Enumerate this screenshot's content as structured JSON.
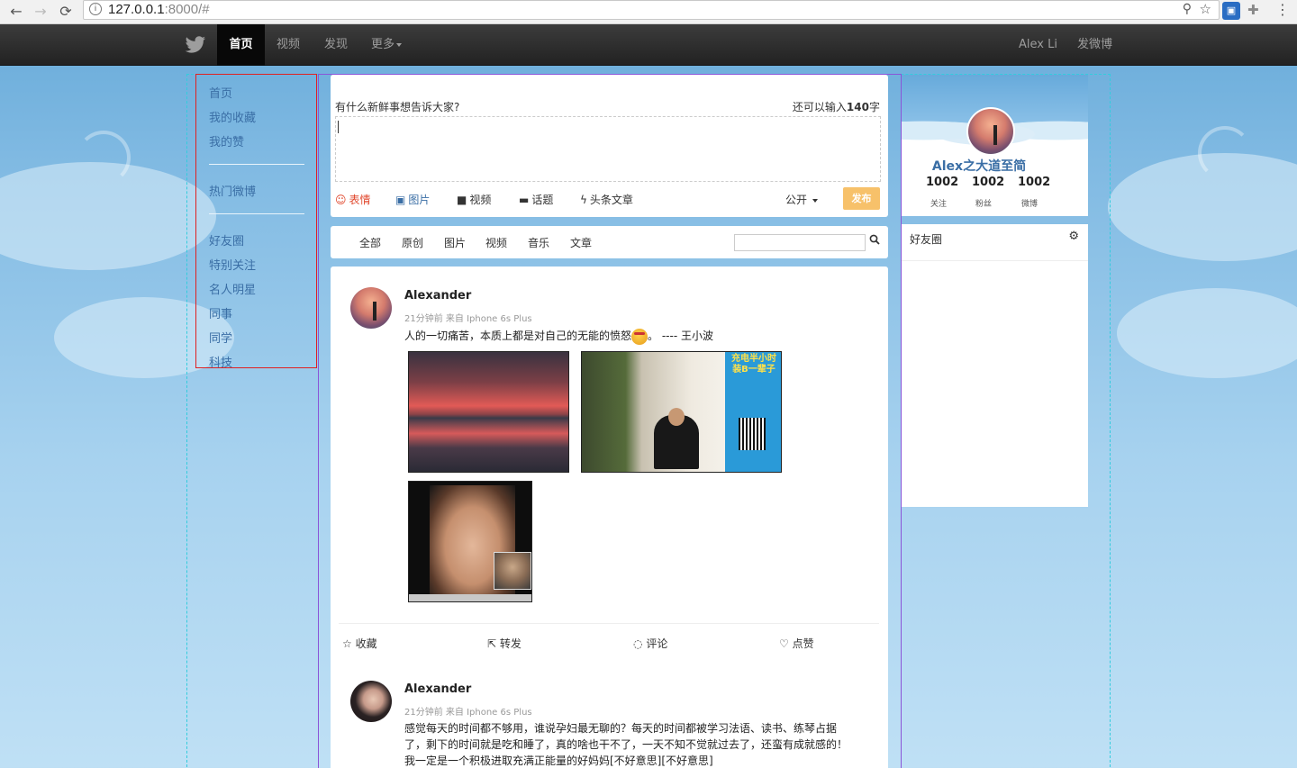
{
  "browser": {
    "url_host": "127.0.0.1",
    "url_path": ":8000/#"
  },
  "navbar": {
    "tabs": [
      {
        "label": "首页"
      },
      {
        "label": "视频"
      },
      {
        "label": "发现"
      },
      {
        "label": "更多"
      }
    ],
    "user_name": "Alex Li",
    "post_link": "发微博"
  },
  "sidebar": {
    "items": [
      {
        "label": "首页"
      },
      {
        "label": "我的收藏"
      },
      {
        "label": "我的赞"
      },
      {
        "label": "热门微博"
      },
      {
        "label": "好友圈"
      },
      {
        "label": "特别关注"
      },
      {
        "label": "名人明星"
      },
      {
        "label": "同事"
      },
      {
        "label": "同学"
      },
      {
        "label": "科技"
      }
    ]
  },
  "composer": {
    "prompt": "有什么新鲜事想告诉大家?",
    "count_prefix": "还可以输入",
    "count_number": "140",
    "count_suffix": "字",
    "tools": [
      {
        "label": "表情",
        "icon": "smile-icon"
      },
      {
        "label": "图片",
        "icon": "image-icon"
      },
      {
        "label": "视频",
        "icon": "video-icon"
      },
      {
        "label": "话题",
        "icon": "topic-icon"
      },
      {
        "label": "头条文章",
        "icon": "bolt-icon"
      }
    ],
    "visibility": "公开",
    "publish_label": "发布"
  },
  "filters": {
    "tabs": [
      {
        "label": "全部"
      },
      {
        "label": "原创"
      },
      {
        "label": "图片"
      },
      {
        "label": "视频"
      },
      {
        "label": "音乐"
      },
      {
        "label": "文章"
      }
    ],
    "search_value": ""
  },
  "posts": [
    {
      "author": "Alexander",
      "meta": "21分钟前 来自 Iphone 6s Plus",
      "text_before": "人的一切痛苦，本质上都是对自己的无能的愤怒",
      "text_after": "。 ---- 王小波",
      "photos": [
        {
          "alt": "sunset"
        },
        {
          "alt": "room",
          "sign": "充电半小时 装B一辈子"
        },
        {
          "alt": "selfie"
        }
      ],
      "actions": [
        {
          "label": "收藏",
          "icon": "star-outline-icon"
        },
        {
          "label": "转发",
          "icon": "share-icon"
        },
        {
          "label": "评论",
          "icon": "comment-icon"
        },
        {
          "label": "点赞",
          "icon": "thumbs-up-icon"
        }
      ]
    },
    {
      "author": "Alexander",
      "meta": "21分钟前 来自 Iphone 6s Plus",
      "text": "感觉每天的时间都不够用，谁说孕妇最无聊的？每天的时间都被学习法语、读书、练琴占据了，剩下的时间就是吃和睡了，真的啥也干不了，一天不知不觉就过去了，还蛮有成就感的！我一定是一个积极进取充满正能量的好妈妈[不好意思][不好意思]"
    }
  ],
  "profile": {
    "name": "Alex之大道至简",
    "stats": [
      {
        "value": "1002",
        "label": "关注"
      },
      {
        "value": "1002",
        "label": "粉丝"
      },
      {
        "value": "1002",
        "label": "微博"
      }
    ]
  },
  "friends_panel": {
    "title": "好友圈"
  },
  "colors": {
    "link": "#3a6ea5",
    "publish": "#f7c16a",
    "emoji_tool": "#e0462b",
    "navbar": "#222222"
  }
}
